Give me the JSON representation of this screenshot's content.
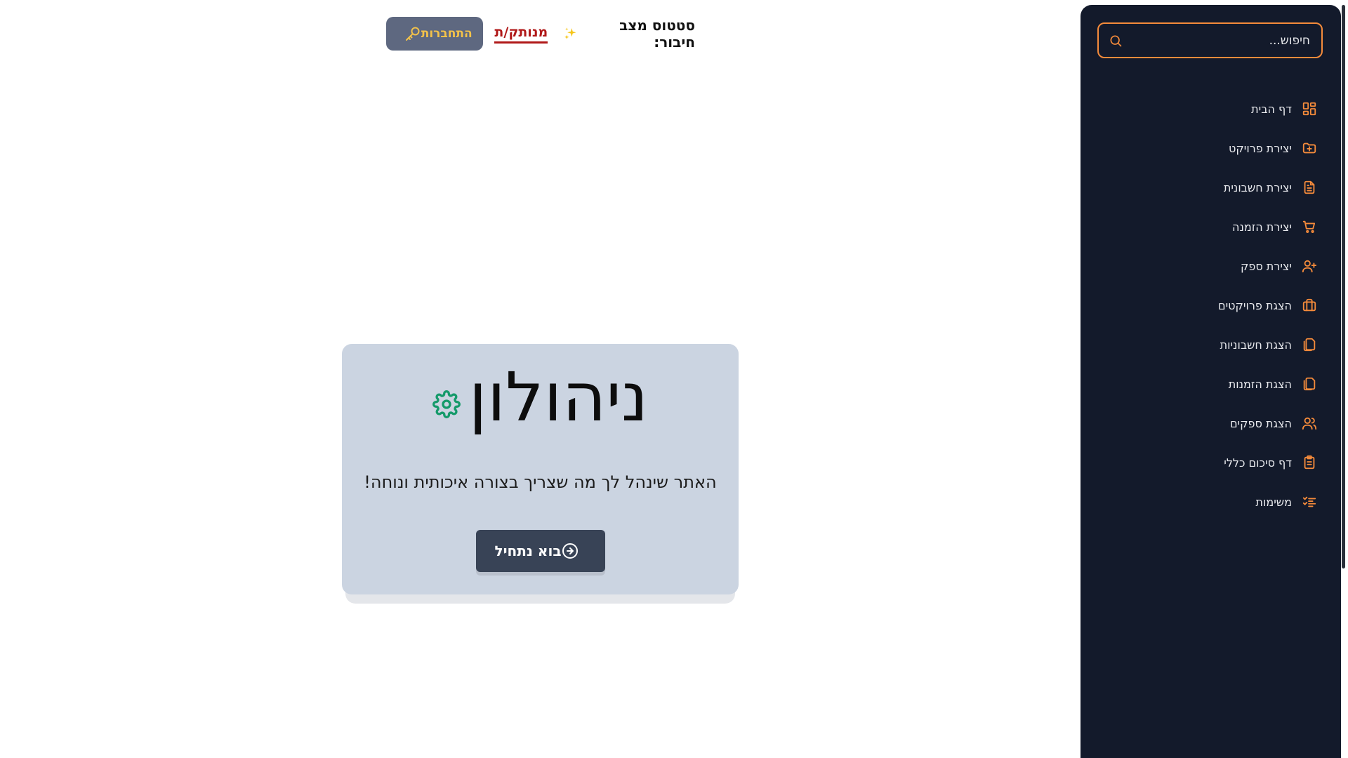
{
  "header": {
    "status_title": "סטטוס מצב חיבור:",
    "status_value": "מנותק/ת",
    "login_label": "התחברות"
  },
  "hero": {
    "brand": "ניהולון",
    "tagline": "האתר שינהל לך מה שצריך בצורה איכותית ונוחה!",
    "cta_label": "בוא נתחיל"
  },
  "sidebar": {
    "search_placeholder": "חיפוש...",
    "items": [
      {
        "label": "דף הבית",
        "icon": "grid-icon"
      },
      {
        "label": "יצירת פרויקט",
        "icon": "folder-plus-icon"
      },
      {
        "label": "יצירת חשבונית",
        "icon": "file-text-icon"
      },
      {
        "label": "יצירת הזמנה",
        "icon": "cart-icon"
      },
      {
        "label": "יצירת ספק",
        "icon": "user-plus-icon"
      },
      {
        "label": "הצגת פרויקטים",
        "icon": "briefcase-icon"
      },
      {
        "label": "הצגת חשבוניות",
        "icon": "copy-icon"
      },
      {
        "label": "הצגת הזמנות",
        "icon": "copy-icon"
      },
      {
        "label": "הצגת ספקים",
        "icon": "users-icon"
      },
      {
        "label": "דף סיכום כללי",
        "icon": "clipboard-icon"
      },
      {
        "label": "משימות",
        "icon": "list-check-icon"
      }
    ]
  },
  "colors": {
    "sidebar_bg": "#131a2b",
    "accent_orange": "#f58b3b",
    "status_red": "#b01818",
    "login_bg": "#5e6880",
    "login_text": "#f3c24a",
    "card_bg": "#cbd4e1",
    "cta_bg": "#384356",
    "gear_green": "#159a6a"
  }
}
